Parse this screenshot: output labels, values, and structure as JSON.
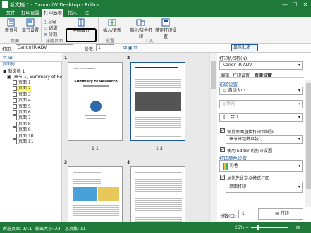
{
  "app": {
    "title": "新文档 1 - Canon iW Desktop - Editor",
    "minimize": "—",
    "maximize": "☐",
    "close": "✕"
  },
  "tabs": [
    {
      "label": "文件"
    },
    {
      "label": "打印设置"
    },
    {
      "label": "打印选项"
    },
    {
      "label": "插入"
    },
    {
      "label": "注"
    }
  ],
  "ribbon": {
    "btn_new": "新页号",
    "btn_chapter": "章节设置",
    "btn_orient": "方向",
    "btn_paper": "纸张",
    "btn_split": "分割",
    "btn_binding": "中国装订",
    "btn_insert": "插入/更新",
    "btn_reduce": "缩小/放大打印",
    "btn_save": "储存打印设置",
    "grp_page": "页面",
    "grp_layout": "排版页面",
    "grp_set": "设置",
    "grp_tools": "工具"
  },
  "toolbar2": {
    "print_label": "打印:",
    "printer": "Canon iR-ADV",
    "copies_label": "份数:",
    "copies": "1",
    "display": "显示批注"
  },
  "left": {
    "header": "页面树",
    "doc": "新文档 1",
    "summary": "[章节 1] Summary of Re",
    "pages": [
      "页面 1",
      "页面 2",
      "页面 3",
      "页面 4",
      "页面 5",
      "页面 6",
      "页面 7",
      "页面 8",
      "页面 9",
      "页面 10",
      "页面 11"
    ]
  },
  "main": {
    "page1": "1",
    "page2": "2",
    "page3": "3",
    "page4": "4",
    "label1": "1-1",
    "label2": "1-2",
    "p1_title": "Summary of Research",
    "p1_sub": "Pm 7XX Corporation"
  },
  "right": {
    "printer_label": "打印机名称(N):",
    "printer": "Canon iR-ADV",
    "tabs": [
      "编辑",
      "打印设置",
      "页面设置"
    ],
    "basic": "布局设置",
    "size": "自动大小",
    "orient": "纵向",
    "nup": "1 合 1",
    "chk1": "保持原图直接打印到纸张",
    "dd1": "章节分组并且装订",
    "chk2": "使用 Editor 的打印设置",
    "color_section": "打印颜色设置",
    "color": "彩色",
    "chk3": "从优先设定点模式打印",
    "dd2": "单面打印",
    "copies_label": "份数(C):",
    "copies": "1",
    "print_btn": "打印"
  },
  "status": {
    "pages": "所选页面: 2/11",
    "size": "输出大小: A4",
    "total": "总页数: 11",
    "zoom": "25%"
  }
}
